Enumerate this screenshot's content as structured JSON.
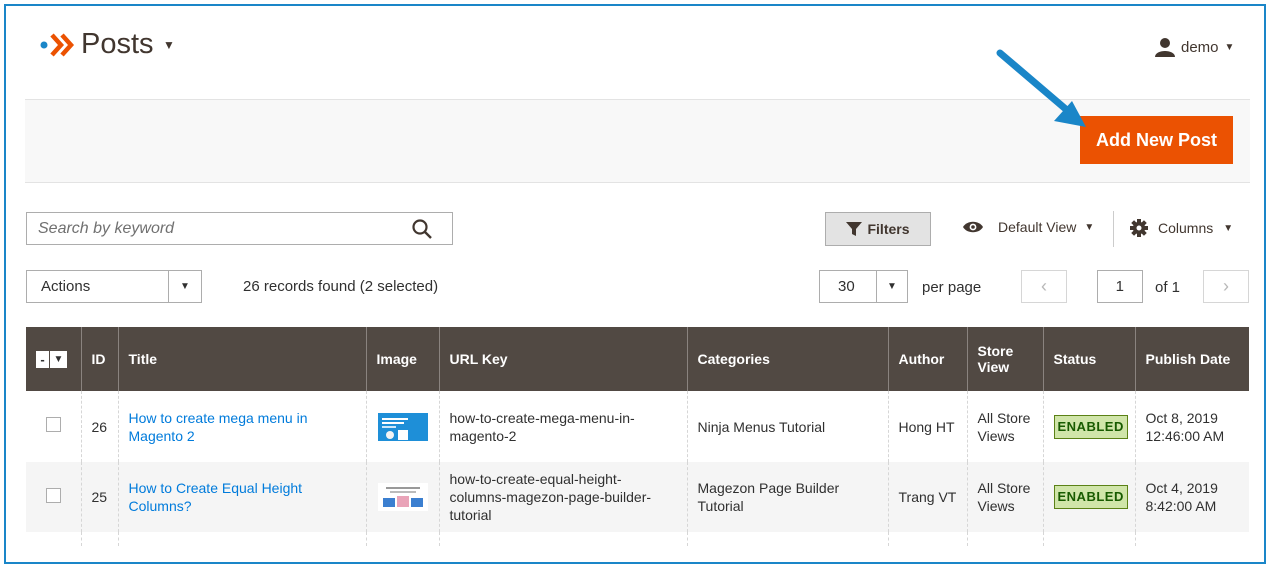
{
  "header": {
    "title": "Posts",
    "user": "demo"
  },
  "actions_bar": {
    "add_button": "Add New Post"
  },
  "toolbar": {
    "search_placeholder": "Search by keyword",
    "filters_label": "Filters",
    "view_label": "Default View",
    "columns_label": "Columns",
    "actions_label": "Actions",
    "records_text": "26 records found (2 selected)",
    "per_page_value": "30",
    "per_page_label": "per page",
    "page_current": "1",
    "page_of": "of 1"
  },
  "grid": {
    "columns": [
      "ID",
      "Title",
      "Image",
      "URL Key",
      "Categories",
      "Author",
      "Store View",
      "Status",
      "Publish Date"
    ],
    "rows": [
      {
        "id": "26",
        "title": "How to create mega menu in Magento 2",
        "url_key": "how-to-create-mega-menu-in-magento-2",
        "categories": "Ninja Menus Tutorial",
        "author": "Hong HT",
        "store_view": "All Store Views",
        "status": "ENABLED",
        "publish_date": "Oct 8, 2019 12:46:00 AM"
      },
      {
        "id": "25",
        "title": "How to Create Equal Height Columns?",
        "url_key": "how-to-create-equal-height-columns-magezon-page-builder-tutorial",
        "categories": "Magezon Page Builder Tutorial",
        "author": "Trang VT",
        "store_view": "All Store Views",
        "status": "ENABLED",
        "publish_date": "Oct 4, 2019 8:42:00 AM"
      }
    ]
  },
  "colors": {
    "accent": "#eb5202",
    "header_bg": "#514943",
    "link": "#007bdb",
    "annotation_arrow": "#1a86c8",
    "enabled_bg": "#d0e5a9"
  }
}
